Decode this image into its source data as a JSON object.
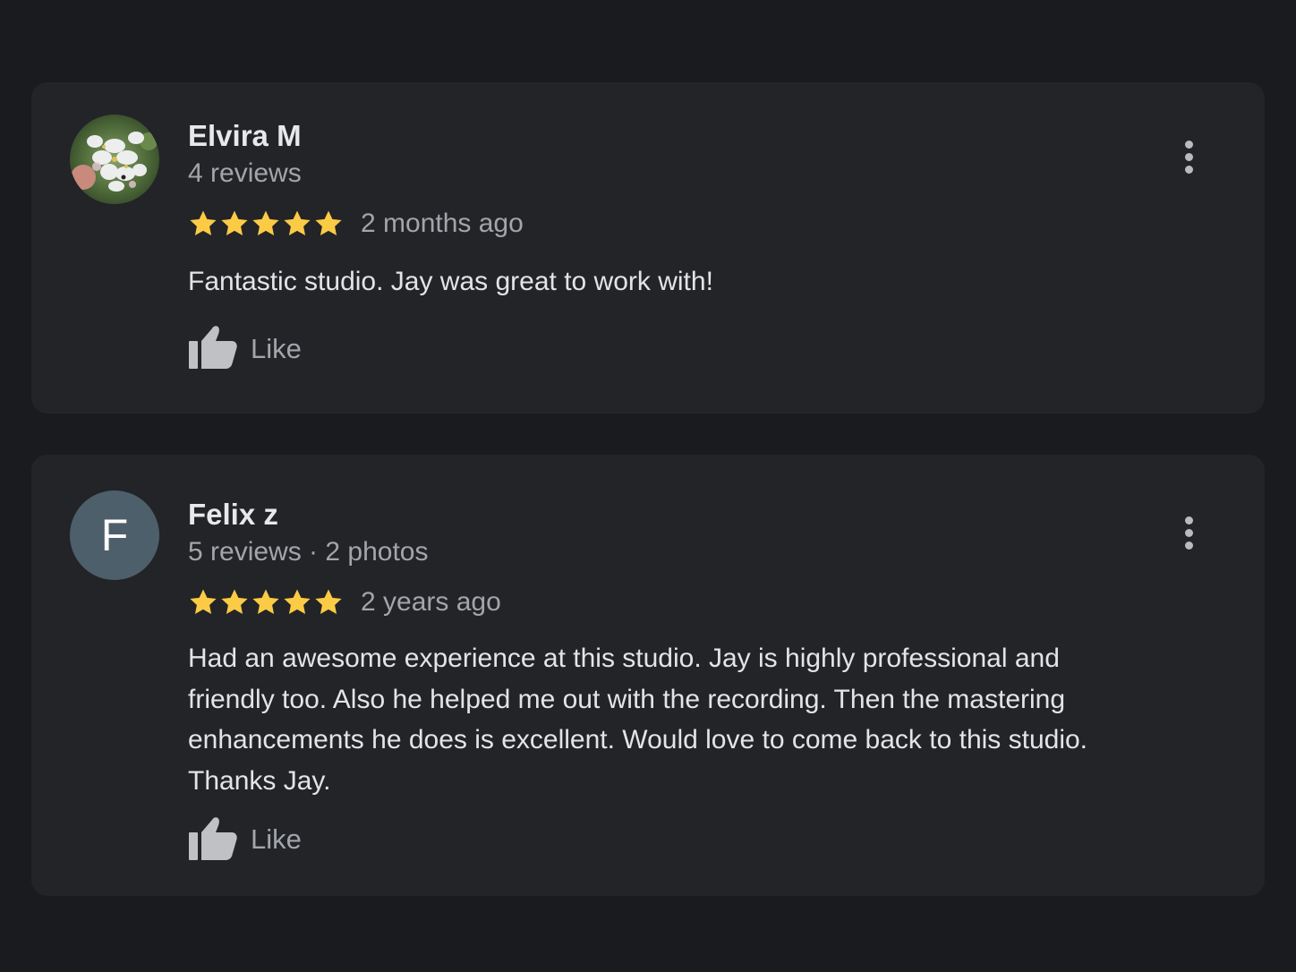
{
  "colors": {
    "background": "#1a1b1e",
    "card": "#232427",
    "star": "#fbcb45",
    "avatar_bg": "#4d5f6b"
  },
  "reviews": [
    {
      "author": "Elvira M",
      "meta": "4 reviews",
      "rating": 5,
      "date": "2 months ago",
      "text": "Fantastic studio. Jay was great to work with!",
      "like_label": "Like",
      "avatar": "flower-photo"
    },
    {
      "author": "Felix z",
      "meta": "5 reviews · 2 photos",
      "rating": 5,
      "date": "2 years ago",
      "text": "Had an awesome experience at this studio. Jay is highly professional and friendly too. Also he helped me out with the recording. Then the mastering enhancements he does is excellent. Would love to come back to this studio. Thanks Jay.",
      "like_label": "Like",
      "avatar_letter": "F"
    }
  ]
}
